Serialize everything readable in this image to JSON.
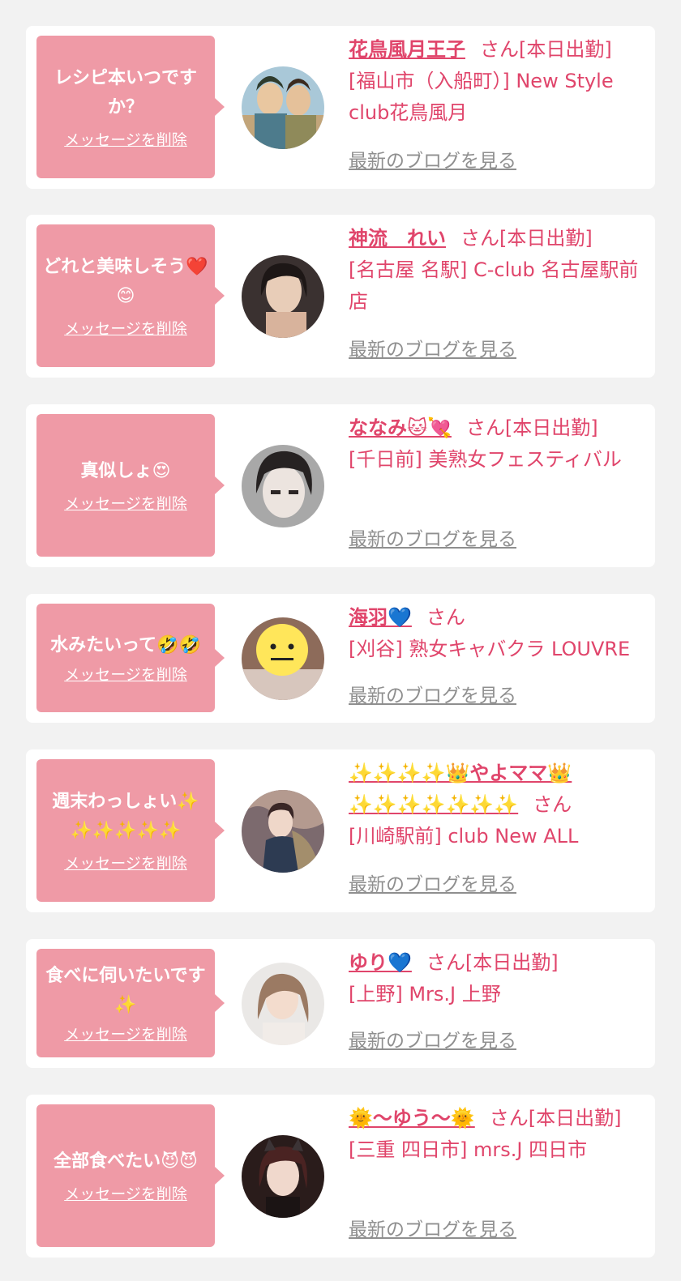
{
  "cards": [
    {
      "message": "レシピ本いつですか？",
      "delete_label": "メッセージを削除",
      "name": "花鳥風月王子",
      "suffix": "さん[本日出勤]",
      "shop": "[福山市（入船町）] New Style club花鳥風月",
      "blog_label": "最新のブログを見る"
    },
    {
      "message": "どれと美味しそう❤️😊",
      "delete_label": "メッセージを削除",
      "name": "神流　れい",
      "suffix": "さん[本日出勤]",
      "shop": "[名古屋 名駅] C-club 名古屋駅前店",
      "blog_label": "最新のブログを見る"
    },
    {
      "message": "真似しょ😍",
      "delete_label": "メッセージを削除",
      "name": "ななみ🐱💘",
      "suffix": "さん[本日出勤]",
      "shop": "[千日前] 美熟女フェスティバル",
      "blog_label": "最新のブログを見る"
    },
    {
      "message": "水みたいって🤣🤣",
      "delete_label": "メッセージを削除",
      "name": "海羽💙",
      "suffix": "さん",
      "shop": "[刈谷] 熟女キャバクラ LOUVRE",
      "blog_label": "最新のブログを見る"
    },
    {
      "message": "週末わっしょい✨✨✨✨✨✨",
      "delete_label": "メッセージを削除",
      "name": "✨✨✨✨👑やよママ👑✨✨✨✨✨✨✨",
      "suffix": "さん",
      "shop": "[川崎駅前] club New ALL",
      "blog_label": "最新のブログを見る"
    },
    {
      "message": "食べに伺いたいです✨",
      "delete_label": "メッセージを削除",
      "name": "ゆり💙",
      "suffix": "さん[本日出勤]",
      "shop": "[上野] Mrs.J 上野",
      "blog_label": "最新のブログを見る"
    },
    {
      "message": "全部食べたい😈😈",
      "delete_label": "メッセージを削除",
      "name": "🌞〜ゆう〜🌞",
      "suffix": "さん[本日出勤]",
      "shop": "[三重 四日市] mrs.J 四日市",
      "blog_label": "最新のブログを見る"
    }
  ]
}
